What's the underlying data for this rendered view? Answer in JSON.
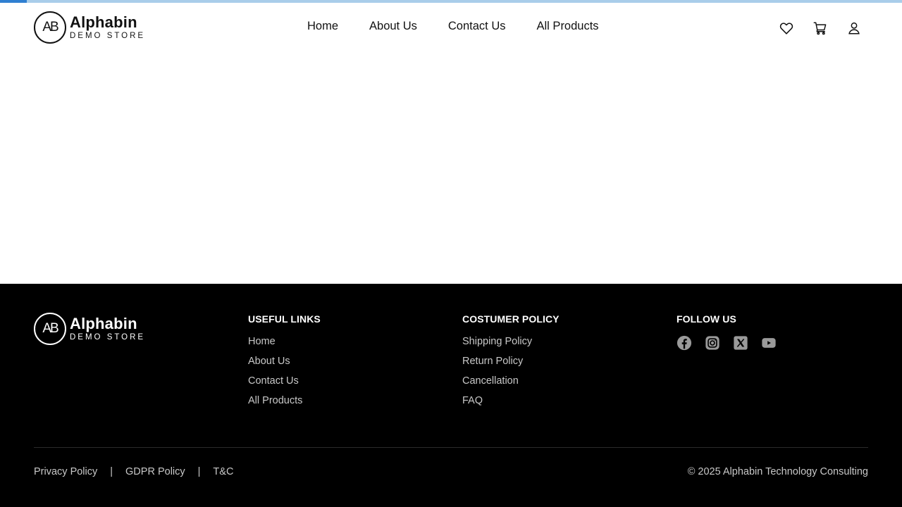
{
  "page_load_progress": 0.03,
  "brand": {
    "mark": "AB",
    "name": "Alphabin",
    "tagline": "DEMO STORE"
  },
  "nav": [
    {
      "label": "Home"
    },
    {
      "label": "About Us"
    },
    {
      "label": "Contact Us"
    },
    {
      "label": "All Products"
    }
  ],
  "header_icons": [
    "heart-icon",
    "cart-icon",
    "user-icon"
  ],
  "footer": {
    "useful_links": {
      "title": "USEFUL LINKS",
      "items": [
        "Home",
        "About Us",
        "Contact Us",
        "All Products"
      ]
    },
    "customer_policy": {
      "title": "COSTUMER POLICY",
      "items": [
        "Shipping Policy",
        "Return Policy",
        "Cancellation",
        "FAQ"
      ]
    },
    "follow_us": {
      "title": "FOLLOW US",
      "icons": [
        "facebook-icon",
        "instagram-icon",
        "x-icon",
        "youtube-icon"
      ]
    },
    "legal": {
      "privacy": "Privacy Policy",
      "separator": "|",
      "gdpr": "GDPR Policy",
      "tc": "T&C"
    },
    "copyright": "© 2025 Alphabin Technology Consulting"
  },
  "colors": {
    "progress_fill": "#2f7fd1",
    "progress_track": "#a9cdea",
    "footer_bg": "#000000",
    "footer_link": "#c8c8c8",
    "social_icon": "#9a9a9a"
  }
}
